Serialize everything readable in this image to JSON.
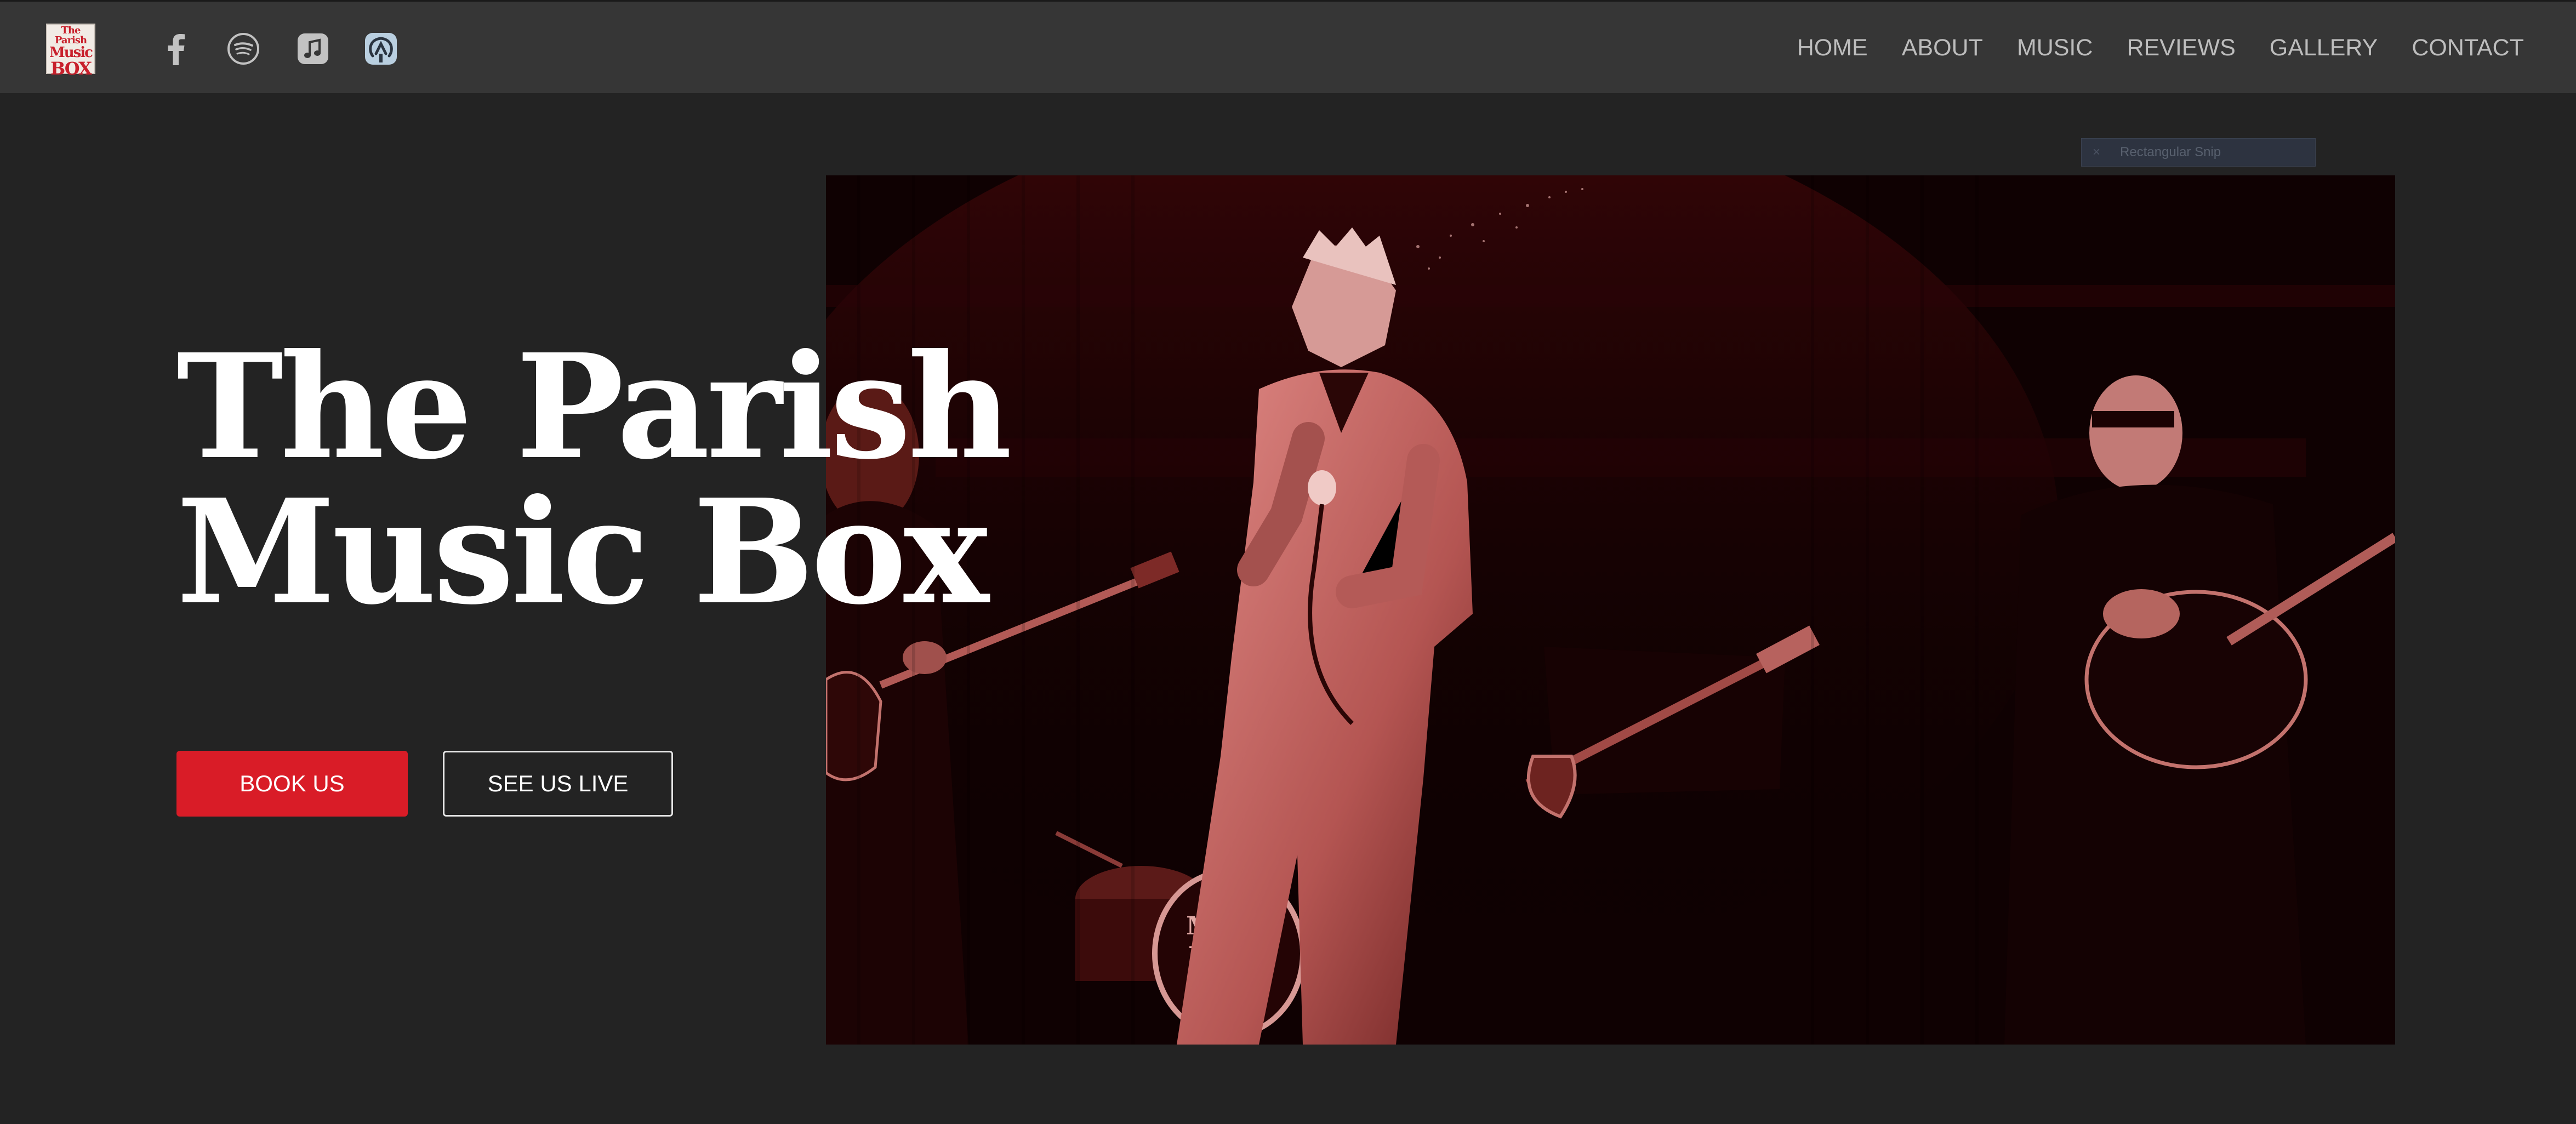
{
  "logo": {
    "line1": "The Parish",
    "line2": "Music",
    "line3": "BOX"
  },
  "social": [
    {
      "icon": "facebook-icon"
    },
    {
      "icon": "spotify-icon"
    },
    {
      "icon": "apple-music-icon"
    },
    {
      "icon": "podcast-icon"
    }
  ],
  "nav": {
    "items": [
      {
        "label": "HOME"
      },
      {
        "label": "ABOUT"
      },
      {
        "label": "MUSIC"
      },
      {
        "label": "REVIEWS"
      },
      {
        "label": "GALLERY"
      },
      {
        "label": "CONTACT"
      }
    ]
  },
  "overlay_tag": {
    "close": "×",
    "label": "Rectangular Snip"
  },
  "hero": {
    "title_line1": "The Parish",
    "title_line2": "Music Box",
    "book_label": "BOOK US",
    "live_label": "SEE US LIVE",
    "photo_drum_text": "The Parish Music Box"
  },
  "colors": {
    "background": "#232323",
    "navbar": "#363636",
    "accent": "#d91c27",
    "nav_text": "#bdbdbd"
  }
}
